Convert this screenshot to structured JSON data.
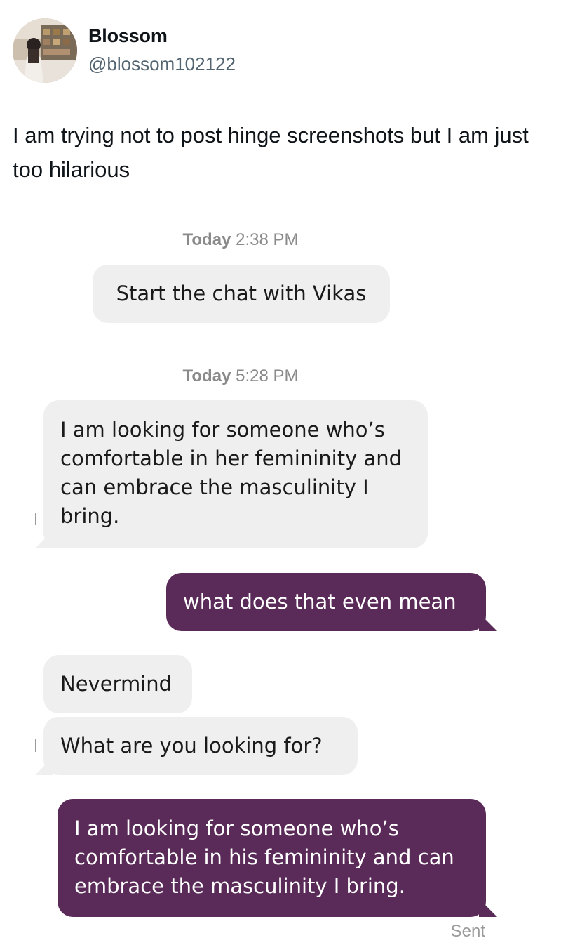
{
  "tweet": {
    "display_name": "Blossom",
    "handle": "@blossom102122",
    "text": "I am trying not to post hinge screenshots but I am just too hilarious"
  },
  "chat": {
    "timestamp_1": {
      "day": "Today",
      "time": "2:38 PM"
    },
    "system_message": "Start the chat with Vikas",
    "timestamp_2": {
      "day": "Today",
      "time": "5:28 PM"
    },
    "messages": [
      {
        "direction": "in",
        "text": "I am looking for someone who’s comfortable in her femininity and can embrace the masculinity I bring."
      },
      {
        "direction": "out",
        "text": "what does that even mean"
      },
      {
        "direction": "in",
        "text": "Nevermind"
      },
      {
        "direction": "in",
        "text": "What are you looking for?"
      },
      {
        "direction": "out",
        "text": "I am looking for someone who’s comfortable in his femininity and can embrace the masculinity I bring."
      }
    ],
    "status": "Sent"
  },
  "colors": {
    "incoming_bubble": "#efefef",
    "outgoing_bubble": "#5a2a58",
    "timestamp_text": "#8a8a8a",
    "handle_text": "#536471"
  },
  "icons": {
    "avatar": "profile-photo"
  }
}
